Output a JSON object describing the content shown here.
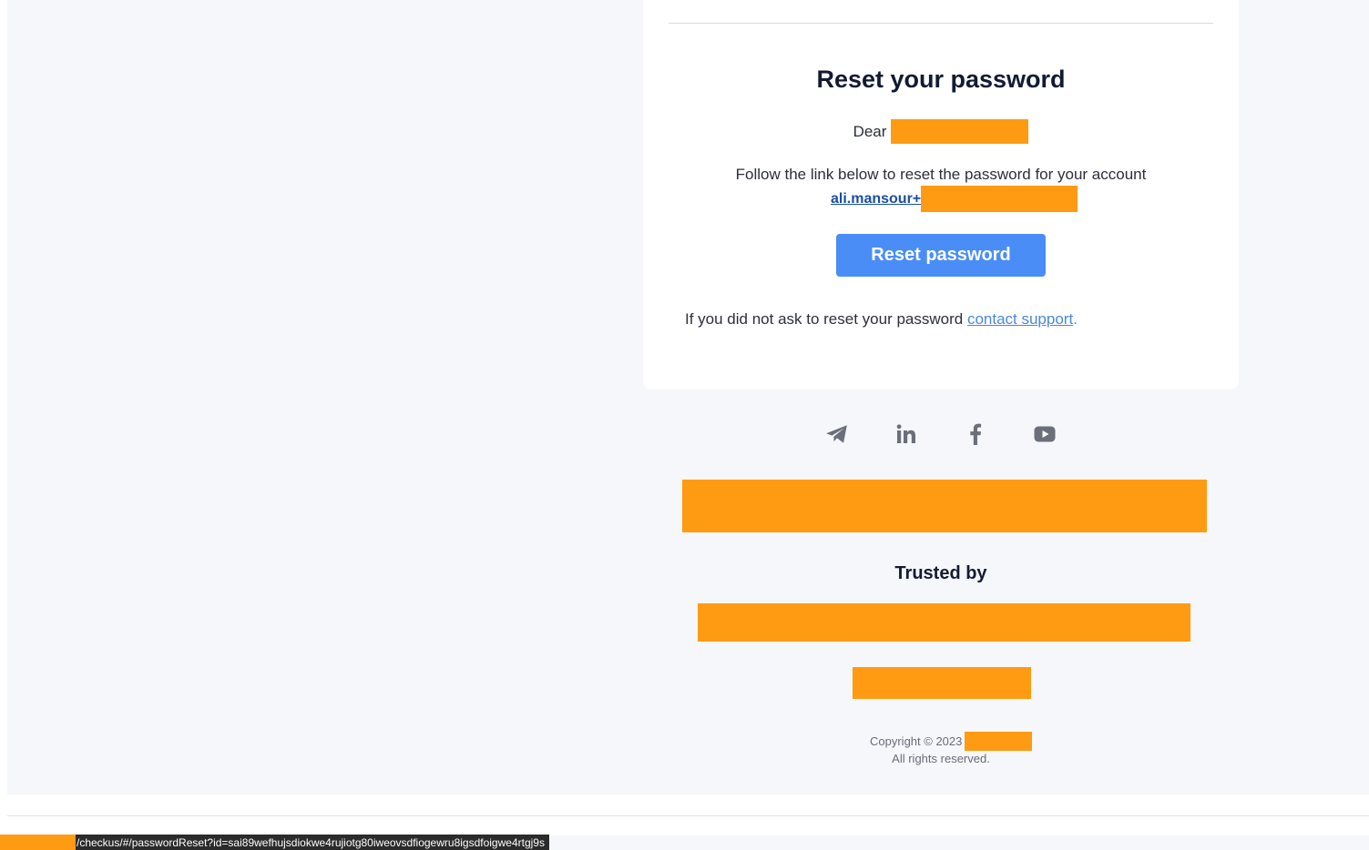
{
  "email": {
    "title": "Reset your password",
    "greeting": "Dear",
    "instruction": "Follow the link below to reset the password for your account",
    "account_email_visible": "ali.mansour+",
    "reset_button_label": "Reset password",
    "support_prefix": "If you did not ask to reset your password ",
    "support_link_label": "contact support",
    "support_suffix": "."
  },
  "footer": {
    "social_icons": [
      "telegram-icon",
      "linkedin-icon",
      "facebook-icon",
      "youtube-icon"
    ],
    "trusted_by_label": "Trusted by",
    "copyright": "Copyright © 2023",
    "rights": "All rights reserved."
  },
  "status_bar": {
    "url": "/checkus/#/passwordReset?id=sai89wefhujsdiokwe4rujiotg80iweovsdfiogewru8igsdfoigwe4rtgj9s"
  },
  "colors": {
    "page_background": "#f6f7fa",
    "card_background": "#ffffff",
    "button": "#4a8df7",
    "link": "#1a4fa0",
    "support_link": "#4a88d8",
    "redaction": "#ff9b12",
    "heading": "#131a33",
    "icon": "#6b6f7a"
  }
}
